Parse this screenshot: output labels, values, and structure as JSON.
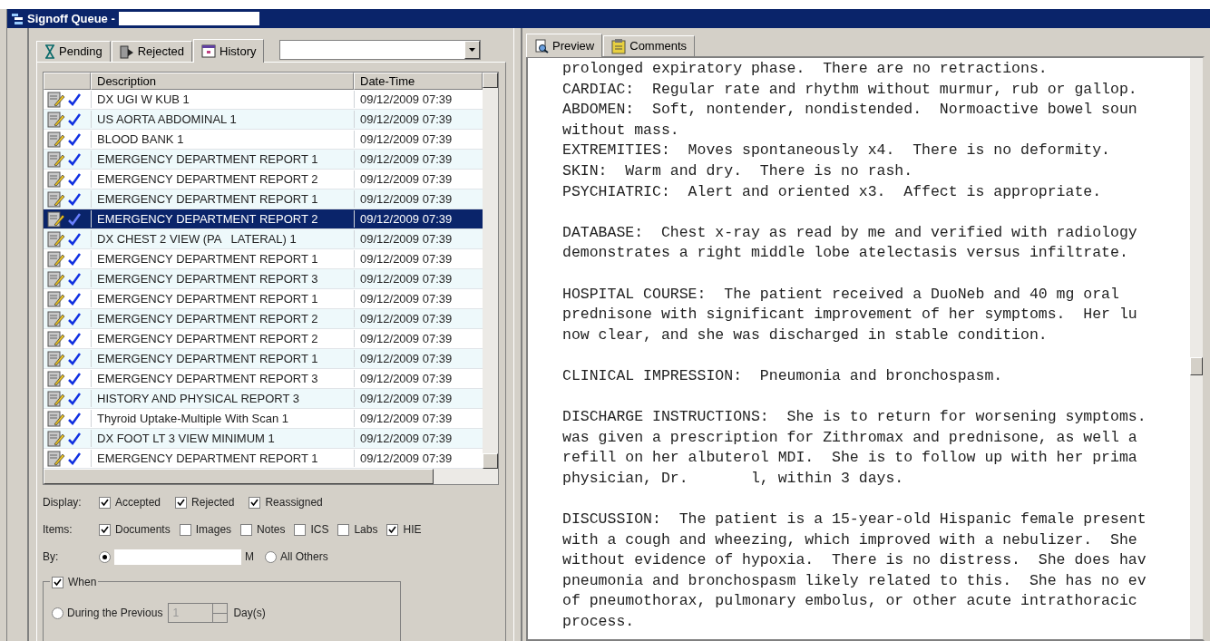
{
  "window": {
    "title": "Signoff Queue -"
  },
  "left_tabs": [
    {
      "label": "Pending",
      "kind": "pending",
      "selected": false
    },
    {
      "label": "Rejected",
      "kind": "rejected",
      "selected": false
    },
    {
      "label": "History",
      "kind": "history",
      "selected": true
    }
  ],
  "table": {
    "columns": [
      "Description",
      "Date-Time"
    ],
    "rows": [
      {
        "description": "DX UGI W KUB 1",
        "date_time": "09/12/2009 07:39",
        "selected": false
      },
      {
        "description": "US AORTA ABDOMINAL 1",
        "date_time": "09/12/2009 07:39",
        "selected": false
      },
      {
        "description": "BLOOD BANK 1",
        "date_time": "09/12/2009 07:39",
        "selected": false
      },
      {
        "description": "EMERGENCY DEPARTMENT REPORT 1",
        "date_time": "09/12/2009 07:39",
        "selected": false
      },
      {
        "description": "EMERGENCY DEPARTMENT REPORT 2",
        "date_time": "09/12/2009 07:39",
        "selected": false
      },
      {
        "description": "EMERGENCY DEPARTMENT REPORT 1",
        "date_time": "09/12/2009 07:39",
        "selected": false
      },
      {
        "description": "EMERGENCY DEPARTMENT REPORT 2",
        "date_time": "09/12/2009 07:39",
        "selected": true
      },
      {
        "description": "DX CHEST 2 VIEW (PA   LATERAL) 1",
        "date_time": "09/12/2009 07:39",
        "selected": false
      },
      {
        "description": "EMERGENCY DEPARTMENT REPORT 1",
        "date_time": "09/12/2009 07:39",
        "selected": false
      },
      {
        "description": "EMERGENCY DEPARTMENT REPORT 3",
        "date_time": "09/12/2009 07:39",
        "selected": false
      },
      {
        "description": "EMERGENCY DEPARTMENT REPORT 1",
        "date_time": "09/12/2009 07:39",
        "selected": false
      },
      {
        "description": "EMERGENCY DEPARTMENT REPORT 2",
        "date_time": "09/12/2009 07:39",
        "selected": false
      },
      {
        "description": "EMERGENCY DEPARTMENT REPORT 2",
        "date_time": "09/12/2009 07:39",
        "selected": false
      },
      {
        "description": "EMERGENCY DEPARTMENT REPORT 1",
        "date_time": "09/12/2009 07:39",
        "selected": false
      },
      {
        "description": "EMERGENCY DEPARTMENT REPORT 3",
        "date_time": "09/12/2009 07:39",
        "selected": false
      },
      {
        "description": "HISTORY AND PHYSICAL REPORT 3",
        "date_time": "09/12/2009 07:39",
        "selected": false
      },
      {
        "description": "Thyroid Uptake-Multiple With Scan 1",
        "date_time": "09/12/2009 07:39",
        "selected": false
      },
      {
        "description": "DX FOOT LT 3 VIEW MINIMUM 1",
        "date_time": "09/12/2009 07:39",
        "selected": false
      },
      {
        "description": "EMERGENCY DEPARTMENT REPORT 1",
        "date_time": "09/12/2009 07:39",
        "selected": false
      }
    ]
  },
  "display": {
    "label": "Display:",
    "options": [
      {
        "label": "Accepted",
        "checked": true
      },
      {
        "label": "Rejected",
        "checked": true
      },
      {
        "label": "Reassigned",
        "checked": true
      }
    ]
  },
  "items": {
    "label": "Items:",
    "options": [
      {
        "label": "Documents",
        "checked": true
      },
      {
        "label": "Images",
        "checked": false
      },
      {
        "label": "Notes",
        "checked": false
      },
      {
        "label": "ICS",
        "checked": false
      },
      {
        "label": "Labs",
        "checked": false
      },
      {
        "label": "HIE",
        "checked": true
      }
    ]
  },
  "by": {
    "label": "By:",
    "options": [
      {
        "label": "M",
        "selected": true
      },
      {
        "label": "All Others",
        "selected": false
      }
    ]
  },
  "when": {
    "label": "When",
    "checked": true,
    "option": {
      "label": "During the Previous",
      "selected": false
    },
    "value": "1",
    "disabled": true,
    "unit": "Day(s)"
  },
  "right_tabs": [
    {
      "label": "Preview",
      "kind": "preview",
      "selected": true
    },
    {
      "label": "Comments",
      "kind": "comments",
      "selected": false
    }
  ],
  "preview": {
    "paragraphs": [
      [
        "prolonged expiratory phase.  There are no retractions.",
        "CARDIAC:  Regular rate and rhythm without murmur, rub or gallop.",
        "ABDOMEN:  Soft, nontender, nondistended.  Normoactive bowel soun",
        "without mass.",
        "EXTREMITIES:  Moves spontaneously x4.  There is no deformity.",
        "SKIN:  Warm and dry.  There is no rash.",
        "PSYCHIATRIC:  Alert and oriented x3.  Affect is appropriate."
      ],
      [
        "DATABASE:  Chest x-ray as read by me and verified with radiology",
        "demonstrates a right middle lobe atelectasis versus infiltrate."
      ],
      [
        "HOSPITAL COURSE:  The patient received a DuoNeb and 40 mg oral",
        "prednisone with significant improvement of her symptoms.  Her lu",
        "now clear, and she was discharged in stable condition."
      ],
      [
        "CLINICAL IMPRESSION:  Pneumonia and bronchospasm."
      ],
      [
        "DISCHARGE INSTRUCTIONS:  She is to return for worsening symptoms.",
        "was given a prescription for Zithromax and prednisone, as well a",
        "refill on her albuterol MDI.  She is to follow up with her prima",
        "physician, Dr.       l, within 3 days."
      ],
      [
        "DISCUSSION:  The patient is a 15-year-old Hispanic female present",
        "with a cough and wheezing, which improved with a nebulizer.  She",
        "without evidence of hypoxia.  There is no distress.  She does hav",
        "pneumonia and bronchospasm likely related to this.  She has no ev",
        "of pneumothorax, pulmonary embolus, or other acute intrathoracic",
        "process."
      ]
    ]
  }
}
